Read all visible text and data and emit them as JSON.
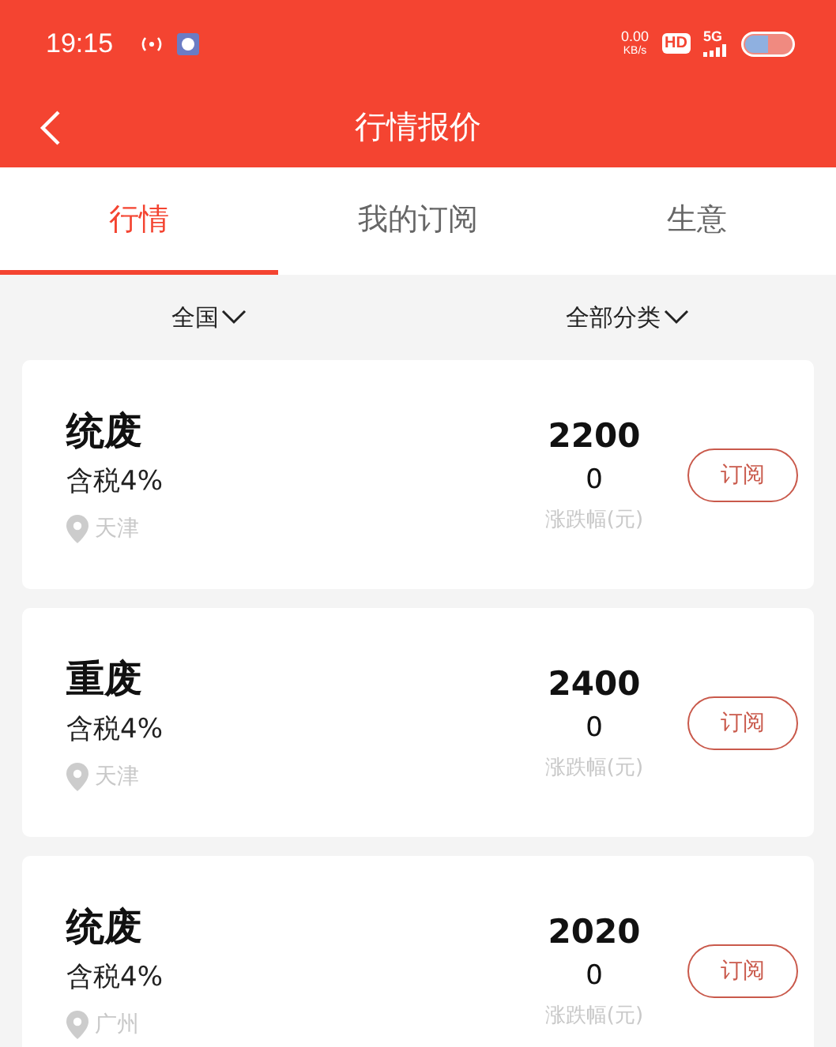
{
  "status_bar": {
    "time": "19:15",
    "net_speed": "0.00",
    "net_unit": "KB/s",
    "hd": "HD",
    "network": "5G"
  },
  "nav": {
    "title": "行情报价"
  },
  "tabs": [
    {
      "label": "行情",
      "selected": true
    },
    {
      "label": "我的订阅",
      "selected": false
    },
    {
      "label": "生意",
      "selected": false
    }
  ],
  "filters": [
    {
      "label": "全国"
    },
    {
      "label": "全部分类"
    }
  ],
  "items": [
    {
      "name": "统废",
      "tax": "含税4%",
      "location": "天津",
      "price": "2200",
      "change": "0",
      "change_label": "涨跌幅(元)",
      "button": "订阅"
    },
    {
      "name": "重废",
      "tax": "含税4%",
      "location": "天津",
      "price": "2400",
      "change": "0",
      "change_label": "涨跌幅(元)",
      "button": "订阅"
    },
    {
      "name": "统废",
      "tax": "含税4%",
      "location": "广州",
      "price": "2020",
      "change": "0",
      "change_label": "涨跌幅(元)",
      "button": "订阅"
    }
  ]
}
